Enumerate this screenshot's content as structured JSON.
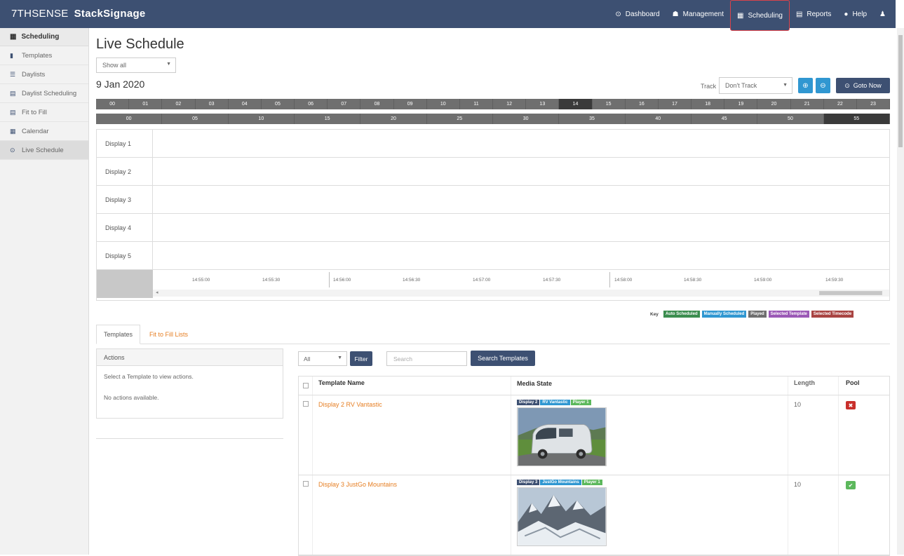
{
  "brand": {
    "logo": "7THSENSE",
    "app": "StackSignage"
  },
  "nav": [
    {
      "icon": "dashboard-icon",
      "glyph": "⊙",
      "label": "Dashboard"
    },
    {
      "icon": "management-icon",
      "glyph": "▬",
      "label": "Management"
    },
    {
      "icon": "scheduling-icon",
      "glyph": "▦",
      "label": "Scheduling"
    },
    {
      "icon": "reports-icon",
      "glyph": "▤",
      "label": "Reports"
    },
    {
      "icon": "help-icon",
      "glyph": "●",
      "label": "Help"
    }
  ],
  "sidebar": {
    "header": "Scheduling",
    "items": [
      {
        "label": "Templates",
        "icon": "templates-icon"
      },
      {
        "label": "Daylists",
        "icon": "daylists-icon"
      },
      {
        "label": "Daylist Scheduling",
        "icon": "daylist-scheduling-icon"
      },
      {
        "label": "Fit to Fill",
        "icon": "fit-to-fill-icon"
      },
      {
        "label": "Calendar",
        "icon": "calendar-icon"
      },
      {
        "label": "Live Schedule",
        "icon": "clock-icon"
      }
    ]
  },
  "main": {
    "title": "Live Schedule",
    "show_select": "Show all",
    "date": "9 Jan 2020",
    "track_label": "Track",
    "track_value": "Don't Track",
    "goto_label": "Goto Now"
  },
  "hours": [
    "00",
    "01",
    "02",
    "03",
    "04",
    "05",
    "06",
    "07",
    "08",
    "09",
    "10",
    "11",
    "12",
    "13",
    "14",
    "15",
    "16",
    "17",
    "18",
    "19",
    "20",
    "21",
    "22",
    "23"
  ],
  "minutes": [
    "00",
    "05",
    "10",
    "15",
    "20",
    "25",
    "30",
    "35",
    "40",
    "45",
    "50",
    "55"
  ],
  "displays": [
    "Display 1",
    "Display 2",
    "Display 3",
    "Display 4",
    "Display 5"
  ],
  "time_ticks": [
    "14:55:00",
    "14:55:30",
    "14:56:00",
    "14:56:30",
    "14:57:00",
    "14:57:30",
    "14:58:00",
    "14:58:30",
    "14:59:00",
    "14:59:30"
  ],
  "key": {
    "label": "Key",
    "items": [
      {
        "label": "Auto Scheduled",
        "color": "#3b8d4f"
      },
      {
        "label": "Manually Scheduled",
        "color": "#3097d1"
      },
      {
        "label": "Played",
        "color": "#6f6f6f"
      },
      {
        "label": "Selected Template",
        "color": "#9b59b6"
      },
      {
        "label": "Selected Timecode",
        "color": "#a94442"
      }
    ]
  },
  "tabs": {
    "templates": "Templates",
    "fit_lists": "Fit to Fill Lists"
  },
  "actions": {
    "header": "Actions",
    "hint": "Select a Template to view actions.",
    "empty": "No actions available."
  },
  "filter": {
    "select": "All",
    "filter_btn": "Filter",
    "search_placeholder": "Search",
    "search_btn": "Search Templates"
  },
  "table": {
    "headers": {
      "name": "Template Name",
      "media": "Media State",
      "length": "Length",
      "pool": "Pool"
    },
    "rows": [
      {
        "name": "Display 2 RV Vantastic",
        "badges": [
          {
            "text": "Display 2",
            "color": "#3d5072"
          },
          {
            "text": "RV Vantastic",
            "color": "#3097d1"
          },
          {
            "text": "Player 1",
            "color": "#5cb85c"
          }
        ],
        "length": "10",
        "pool": "false"
      },
      {
        "name": "Display 3 JustGo Mountains",
        "badges": [
          {
            "text": "Display 3",
            "color": "#3d5072"
          },
          {
            "text": "JustGo Mountains",
            "color": "#3097d1"
          },
          {
            "text": "Player 1",
            "color": "#5cb85c"
          }
        ],
        "length": "10",
        "pool": "true"
      }
    ]
  }
}
